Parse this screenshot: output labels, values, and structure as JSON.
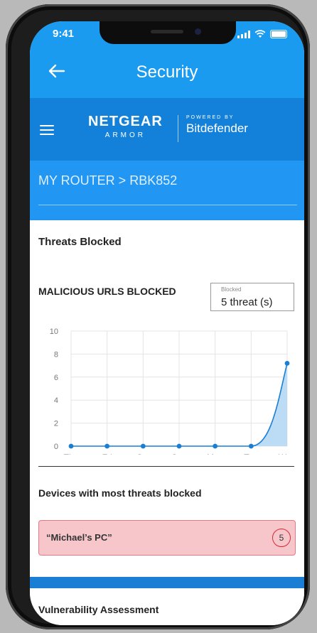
{
  "status_bar": {
    "time": "9:41"
  },
  "header": {
    "title": "Security",
    "back_icon": "arrow-left-icon"
  },
  "brand": {
    "netgear": "NETGEAR",
    "armor": "ARMOR",
    "powered_by": "POWERED BY",
    "bitdefender": "Bitdefender",
    "menu_icon": "hamburger-menu-icon"
  },
  "router": {
    "path": "MY ROUTER > RBK852"
  },
  "threats": {
    "title": "Threats Blocked"
  },
  "malicious": {
    "title": "MALICIOUS URLS BLOCKED",
    "blocked_label": "Blocked",
    "blocked_value": "5 threat (s)"
  },
  "chart_data": {
    "type": "area",
    "categories": [
      "Thu",
      "Fri",
      "Sat",
      "Sun",
      "Mon",
      "Tue",
      "Wed"
    ],
    "values": [
      0,
      0,
      0,
      0,
      0,
      0,
      7.2
    ],
    "ylim": [
      0,
      10
    ],
    "yticks": [
      0,
      2,
      4,
      6,
      8,
      10
    ],
    "grid": true,
    "color": "#1a7fd4"
  },
  "devices": {
    "title": "Devices with most threats blocked",
    "items": [
      {
        "name": "“Michael’s PC”",
        "count": "5"
      }
    ]
  },
  "vulnerability": {
    "title": "Vulnerability Assessment"
  },
  "colors": {
    "header_blue": "#1a9bf0",
    "brand_blue": "#1380d9",
    "router_blue": "#2196f3",
    "device_highlight": "#f6c6cb",
    "count_ring": "#d9272e"
  }
}
